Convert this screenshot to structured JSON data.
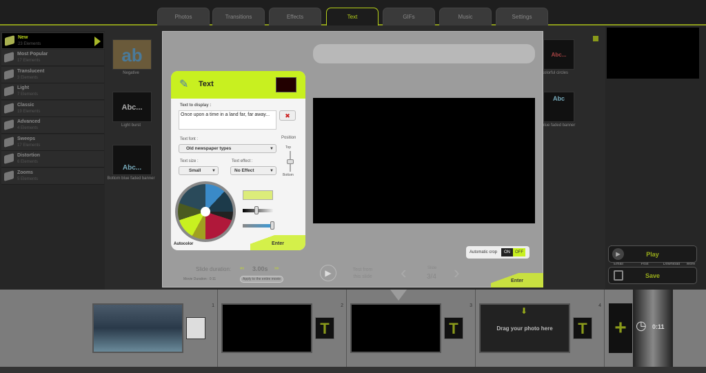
{
  "tabs": [
    "Photos",
    "Transitions",
    "Effects",
    "Text",
    "GIFs",
    "Music",
    "Settings"
  ],
  "active_tab": "Text",
  "sidebar": {
    "items": [
      {
        "label": "New",
        "count": "23 Elements",
        "active": true
      },
      {
        "label": "Most Popular",
        "count": "17 Elements"
      },
      {
        "label": "Translucent",
        "count": "3 Elements"
      },
      {
        "label": "Light",
        "count": "7 Elements"
      },
      {
        "label": "Classic",
        "count": "19 Elements"
      },
      {
        "label": "Advanced",
        "count": "4 Elements"
      },
      {
        "label": "Sweeps",
        "count": "17 Elements"
      },
      {
        "label": "Distortion",
        "count": "6 Elements"
      },
      {
        "label": "Zooms",
        "count": "5 Elements"
      }
    ]
  },
  "thumbnails": [
    {
      "caption": "Negative",
      "glyph": "ab"
    },
    {
      "caption": "Light burst",
      "glyph": "Abc..."
    },
    {
      "caption": "Bottom blue faded banner",
      "glyph": "Abc..."
    },
    {
      "caption": "colorful circles",
      "glyph": "Abc..."
    },
    {
      "caption": "blue faded banner",
      "glyph": "Abc"
    }
  ],
  "text_panel": {
    "title": "Text",
    "text_to_display_label": "Text to display :",
    "text_value": "Once upon a time in a land far, far away...",
    "font_label": "Text font :",
    "font_value": "Old newspaper types",
    "size_label": "Text size :",
    "size_value": "Small",
    "effect_label": "Text effect :",
    "effect_value": "No Effect",
    "position_label": "Position",
    "position_top": "Top",
    "position_bottom": "Bottom",
    "autocolor_label": "Autocolor",
    "enter_label": "Enter",
    "selected_color": "#dcec7a"
  },
  "auto_crop": {
    "label": "Automatic crop",
    "on": "ON",
    "off": "OFF",
    "state": "OFF"
  },
  "duration": {
    "label": "Slide duration:",
    "value": "3.00s",
    "movie_duration": "Movie Duration : 0:11",
    "apply_label": "Apply to the entire movie"
  },
  "test": {
    "line1": "Test from",
    "line2": "this slide"
  },
  "slide_nav": {
    "label": "Slide",
    "value": "3/4"
  },
  "modal_enter": "Enter",
  "right": {
    "share": [
      "Email",
      "Post",
      "Download",
      "More"
    ],
    "play": "Play",
    "save": "Save"
  },
  "film": {
    "slides": [
      "1",
      "2",
      "3",
      "4"
    ],
    "drag_hint": "Drag your photo here",
    "total": "0:11"
  },
  "colors": {
    "accent": "#b8d21a",
    "panel_header": "#c8f020"
  }
}
